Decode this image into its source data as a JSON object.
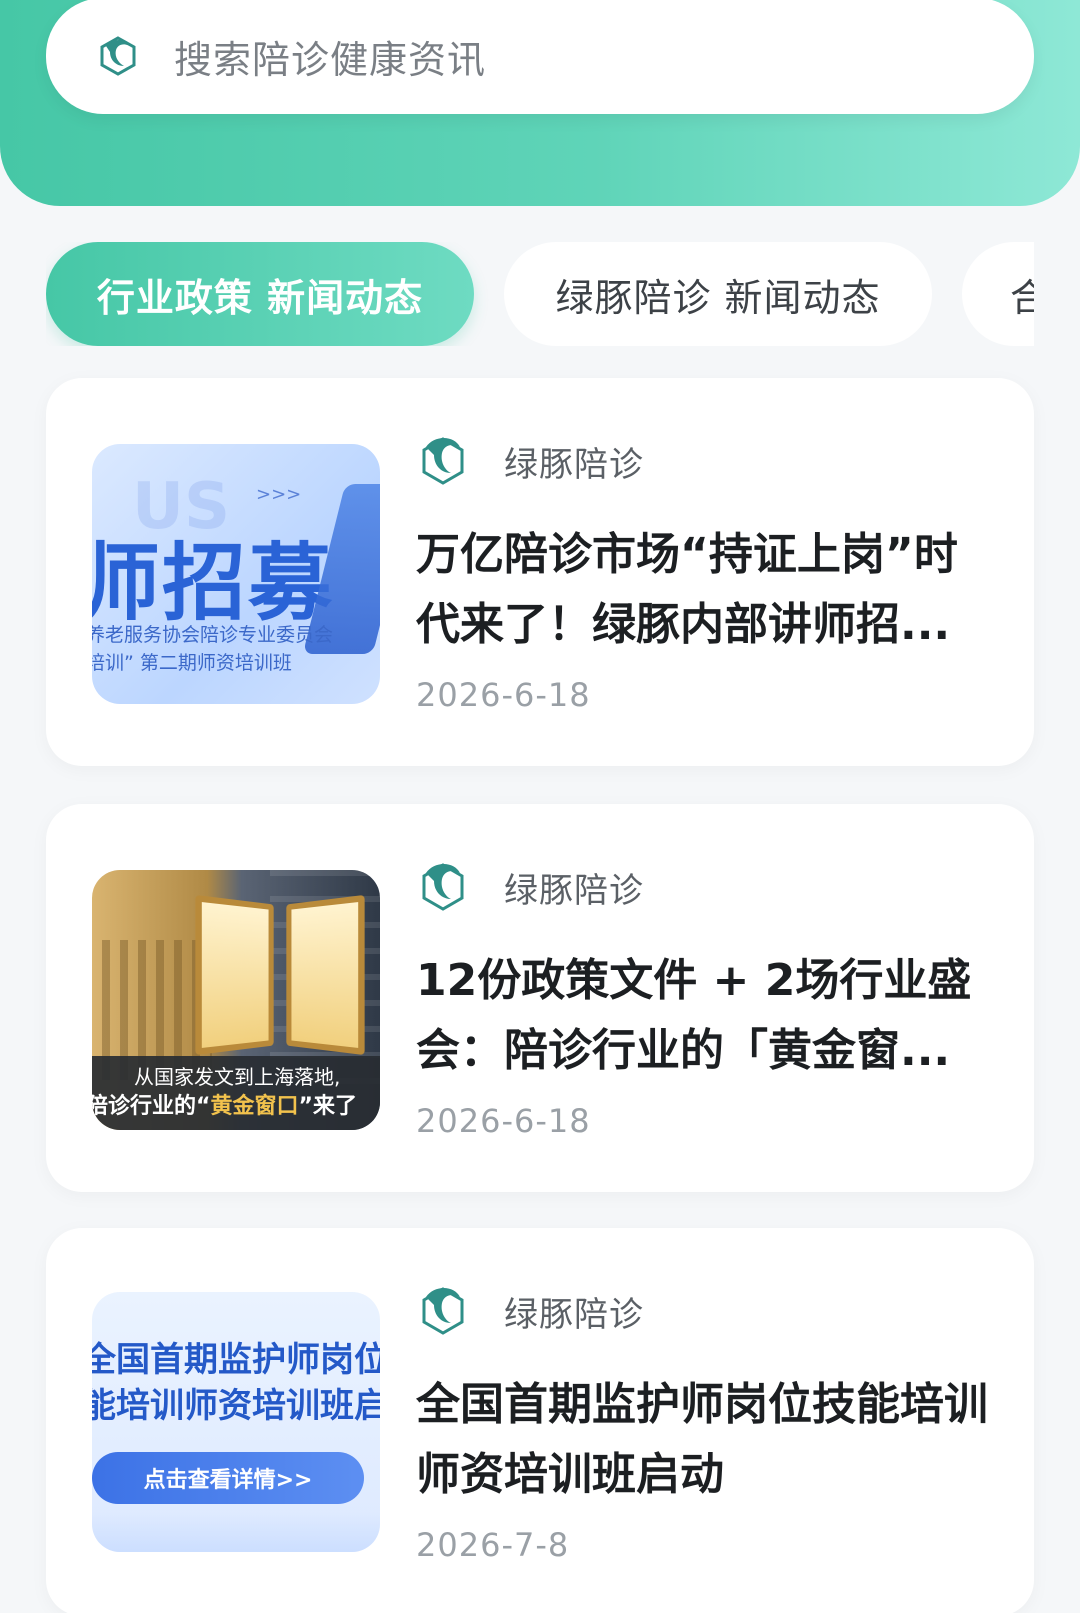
{
  "search": {
    "placeholder": "搜索陪诊健康资讯",
    "icon": "dolphin-logo-icon"
  },
  "tabs": [
    {
      "label": "行业政策 新闻动态",
      "active": true
    },
    {
      "label": "绿豚陪诊 新闻动态",
      "active": false
    },
    {
      "label": "合",
      "active": false
    }
  ],
  "colors": {
    "accent": "#46c7a6",
    "accent_light": "#8ee8d6",
    "background": "#f5f7f9"
  },
  "articles": [
    {
      "source": "绿豚陪诊",
      "title": "万亿陪诊市场“持证上岗”时代来了！绿豚内部讲师招...",
      "date": "2026-6-18",
      "thumbnail": {
        "headline": "师招募",
        "line1": "养老服务协会陪诊专业委员会",
        "line2": "培训” 第二期师资培训班",
        "arrows": ">>>",
        "ghost": "US"
      }
    },
    {
      "source": "绿豚陪诊",
      "title": "12份政策文件 + 2场行业盛会：陪诊行业的「黄金窗...",
      "date": "2026-6-18",
      "thumbnail": {
        "caption1": "从国家发文到上海落地,",
        "caption2_prefix": "陪诊行业的“",
        "caption2_gold": "黄金窗口",
        "caption2_suffix": "”来了"
      }
    },
    {
      "source": "绿豚陪诊",
      "title": "全国首期监护师岗位技能培训师资培训班启动",
      "date": "2026-7-8",
      "thumbnail": {
        "line1": "全国首期监护师岗位",
        "line2": "能培训师资培训班启",
        "button": "点击查看详情>>"
      }
    }
  ]
}
